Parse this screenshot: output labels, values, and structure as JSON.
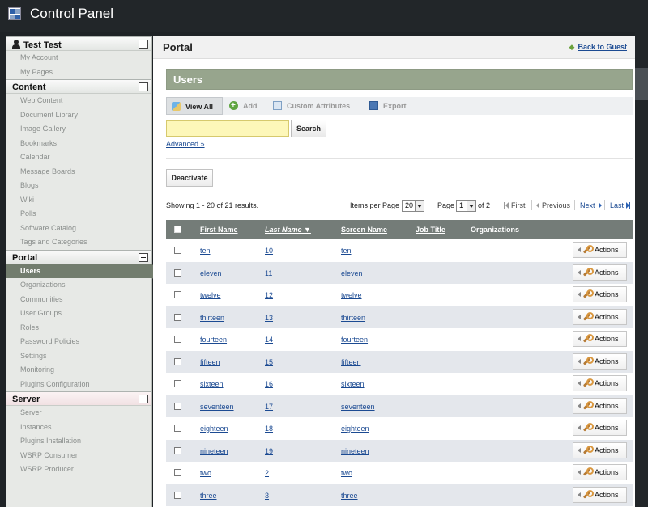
{
  "header": {
    "title": "Control Panel"
  },
  "sidebar": {
    "user_section": {
      "title": "Test Test",
      "items": [
        "My Account",
        "My Pages"
      ]
    },
    "content_section": {
      "title": "Content",
      "items": [
        "Web Content",
        "Document Library",
        "Image Gallery",
        "Bookmarks",
        "Calendar",
        "Message Boards",
        "Blogs",
        "Wiki",
        "Polls",
        "Software Catalog",
        "Tags and Categories"
      ]
    },
    "portal_section": {
      "title": "Portal",
      "items": [
        "Users",
        "Organizations",
        "Communities",
        "User Groups",
        "Roles",
        "Password Policies",
        "Settings",
        "Monitoring",
        "Plugins Configuration"
      ],
      "active": "Users"
    },
    "server_section": {
      "title": "Server",
      "items": [
        "Server",
        "Instances",
        "Plugins Installation",
        "WSRP Consumer",
        "WSRP Producer"
      ]
    }
  },
  "main": {
    "title": "Portal",
    "back_link": "Back to Guest",
    "portlet_title": "Users",
    "tabs": {
      "view_all": "View All",
      "add": "Add",
      "custom_attributes": "Custom Attributes",
      "export": "Export"
    },
    "search": {
      "value": "",
      "button": "Search",
      "advanced": "Advanced »"
    },
    "deactivate_button": "Deactivate",
    "pagination": {
      "results": "Showing 1 - 20 of 21 results.",
      "items_per_page_label": "Items per Page",
      "items_per_page": "20",
      "page_label": "Page",
      "page": "1",
      "of_label": "of 2",
      "first": "First",
      "previous": "Previous",
      "next": "Next",
      "last": "Last"
    },
    "table": {
      "columns": {
        "first_name": "First Name",
        "last_name": "Last Name ▼",
        "screen_name": "Screen Name",
        "job_title": "Job Title",
        "organizations": "Organizations"
      },
      "action_label": "Actions",
      "rows": [
        {
          "first": "ten",
          "last": "10",
          "screen": "ten"
        },
        {
          "first": "eleven",
          "last": "11",
          "screen": "eleven"
        },
        {
          "first": "twelve",
          "last": "12",
          "screen": "twelve"
        },
        {
          "first": "thirteen",
          "last": "13",
          "screen": "thirteen"
        },
        {
          "first": "fourteen",
          "last": "14",
          "screen": "fourteen"
        },
        {
          "first": "fifteen",
          "last": "15",
          "screen": "fifteen"
        },
        {
          "first": "sixteen",
          "last": "16",
          "screen": "sixteen"
        },
        {
          "first": "seventeen",
          "last": "17",
          "screen": "seventeen"
        },
        {
          "first": "eighteen",
          "last": "18",
          "screen": "eighteen"
        },
        {
          "first": "nineteen",
          "last": "19",
          "screen": "nineteen"
        },
        {
          "first": "two",
          "last": "2",
          "screen": "two"
        },
        {
          "first": "three",
          "last": "3",
          "screen": "three"
        }
      ]
    }
  },
  "colors": {
    "topbar": "#222629",
    "portlet_header": "#97a58d",
    "table_header": "#747c78",
    "active_nav": "#727d6e",
    "link": "#1b4a92"
  }
}
